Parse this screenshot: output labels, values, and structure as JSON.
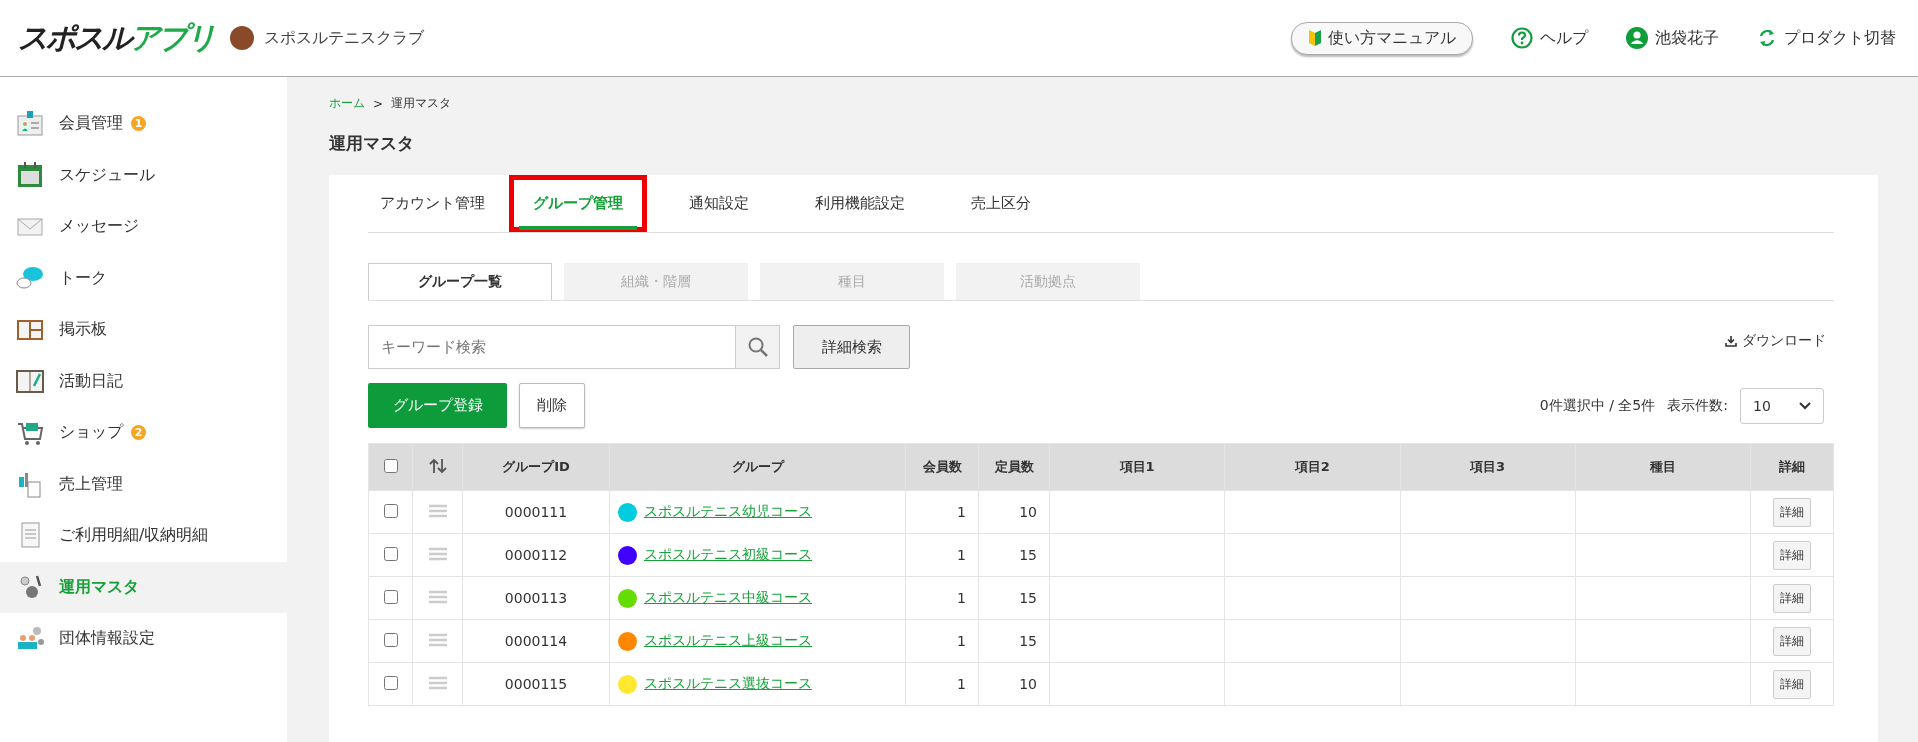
{
  "header": {
    "logo_dark": "スポスル",
    "logo_green": "アプリ",
    "club_name": "スポスルテニスクラブ",
    "links": [
      {
        "kind": "manual",
        "label": "使い方マニュアル"
      },
      {
        "kind": "help",
        "label": "ヘルプ"
      },
      {
        "kind": "user",
        "label": "池袋花子"
      },
      {
        "kind": "switch",
        "label": "プロダクト切替"
      }
    ]
  },
  "sidebar": {
    "items": [
      {
        "label": "会員管理",
        "badge": "1",
        "selected": false
      },
      {
        "label": "スケジュール",
        "selected": false
      },
      {
        "label": "メッセージ",
        "selected": false
      },
      {
        "label": "トーク",
        "selected": false
      },
      {
        "label": "掲示板",
        "selected": false
      },
      {
        "label": "活動日記",
        "selected": false
      },
      {
        "label": "ショップ",
        "badge": "2",
        "selected": false
      },
      {
        "label": "売上管理",
        "selected": false
      },
      {
        "label": "ご利用明細/収納明細",
        "selected": false
      },
      {
        "label": "運用マスタ",
        "selected": true
      },
      {
        "label": "団体情報設定",
        "selected": false
      }
    ]
  },
  "breadcrumb": {
    "home": "ホーム",
    "separator": ">",
    "current": "運用マスタ"
  },
  "page_title": "運用マスタ",
  "tabs": [
    {
      "label": "アカウント管理",
      "selected": false,
      "highlighted": false
    },
    {
      "label": "グループ管理",
      "selected": true,
      "highlighted": true
    },
    {
      "label": "通知設定",
      "selected": false,
      "highlighted": false
    },
    {
      "label": "利用機能設定",
      "selected": false,
      "highlighted": false
    },
    {
      "label": "売上区分",
      "selected": false,
      "highlighted": false
    }
  ],
  "subtabs": [
    {
      "label": "グループ一覧",
      "selected": true
    },
    {
      "label": "組織・階層",
      "selected": false
    },
    {
      "label": "種目",
      "selected": false
    },
    {
      "label": "活動拠点",
      "selected": false
    }
  ],
  "search": {
    "placeholder": "キーワード検索",
    "detail_button": "詳細検索"
  },
  "download": "ダウンロード",
  "actions": {
    "register": "グループ登録",
    "delete": "削除"
  },
  "selection_summary": "0件選択中 / 全5件",
  "page_size": {
    "label": "表示件数:",
    "value": "10"
  },
  "table": {
    "header_checked": false,
    "columns": [
      "グループID",
      "グループ",
      "会員数",
      "定員数",
      "項目1",
      "項目2",
      "項目3",
      "種目",
      "詳細"
    ],
    "rows": [
      {
        "checked": false,
        "id": "0000111",
        "group": "スポスルテニス幼児コース",
        "color": "#00ccdd",
        "members": "1",
        "capacity": "10",
        "detail": "詳細"
      },
      {
        "checked": false,
        "id": "0000112",
        "group": "スポスルテニス初級コース",
        "color": "#4000ff",
        "members": "1",
        "capacity": "15",
        "detail": "詳細"
      },
      {
        "checked": false,
        "id": "0000113",
        "group": "スポスルテニス中級コース",
        "color": "#66dd00",
        "members": "1",
        "capacity": "15",
        "detail": "詳細"
      },
      {
        "checked": false,
        "id": "0000114",
        "group": "スポスルテニス上級コース",
        "color": "#ff8800",
        "members": "1",
        "capacity": "15",
        "detail": "詳細"
      },
      {
        "checked": false,
        "id": "0000115",
        "group": "スポスルテニス選抜コース",
        "color": "#ffe830",
        "members": "1",
        "capacity": "10",
        "detail": "詳細"
      }
    ]
  }
}
